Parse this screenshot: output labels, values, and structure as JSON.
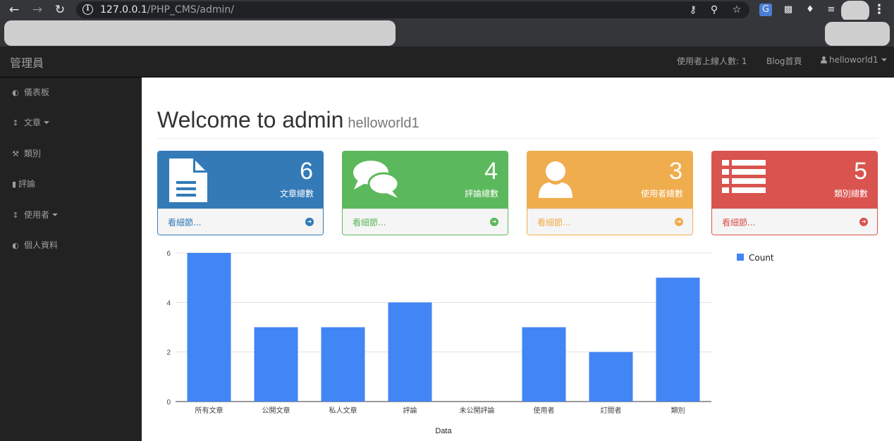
{
  "browser": {
    "url_host": "127.0.0.1",
    "url_path": "/PHP_CMS/admin/"
  },
  "navbar": {
    "brand": "管理員",
    "online_users": "使用者上線人數: 1",
    "blog_home": "Blog首頁",
    "user_menu": "helloworld1"
  },
  "sidebar": {
    "items": [
      {
        "label": "儀表板",
        "icon": "dashboard-icon"
      },
      {
        "label": "文章",
        "icon": "arrows-v-icon",
        "dropdown": true
      },
      {
        "label": "類別",
        "icon": "wrench-icon"
      },
      {
        "label": "評論",
        "icon": "file-icon"
      },
      {
        "label": "使用者",
        "icon": "arrows-v-icon",
        "dropdown": true
      },
      {
        "label": "個人資料",
        "icon": "dashboard-icon"
      }
    ]
  },
  "header": {
    "title": "Welcome to admin",
    "subtitle": "helloworld1"
  },
  "panels": [
    {
      "count": "6",
      "label": "文章總數",
      "link": "看細節...",
      "icon": "file-text-icon",
      "color": "#337ab7"
    },
    {
      "count": "4",
      "label": "評論總數",
      "link": "看細節...",
      "icon": "comments-icon",
      "color": "#5cb85c"
    },
    {
      "count": "3",
      "label": "使用者總數",
      "link": "看細節...",
      "icon": "user-icon",
      "color": "#f0ad4e"
    },
    {
      "count": "5",
      "label": "類別總數",
      "link": "看細節...",
      "icon": "list-icon",
      "color": "#d9534f"
    }
  ],
  "chart_data": {
    "type": "bar",
    "categories": [
      "所有文章",
      "公開文章",
      "私人文章",
      "評論",
      "未公開評論",
      "使用者",
      "訂閱者",
      "類別"
    ],
    "series": [
      {
        "name": "Count",
        "values": [
          6,
          3,
          3,
          4,
          0,
          3,
          2,
          5
        ]
      }
    ],
    "xlabel": "Data",
    "ylabel": "",
    "ylim": [
      0,
      6
    ],
    "yticks": [
      0,
      2,
      4,
      6
    ],
    "grid": true,
    "legend_position": "right",
    "color": "#4285f4"
  }
}
